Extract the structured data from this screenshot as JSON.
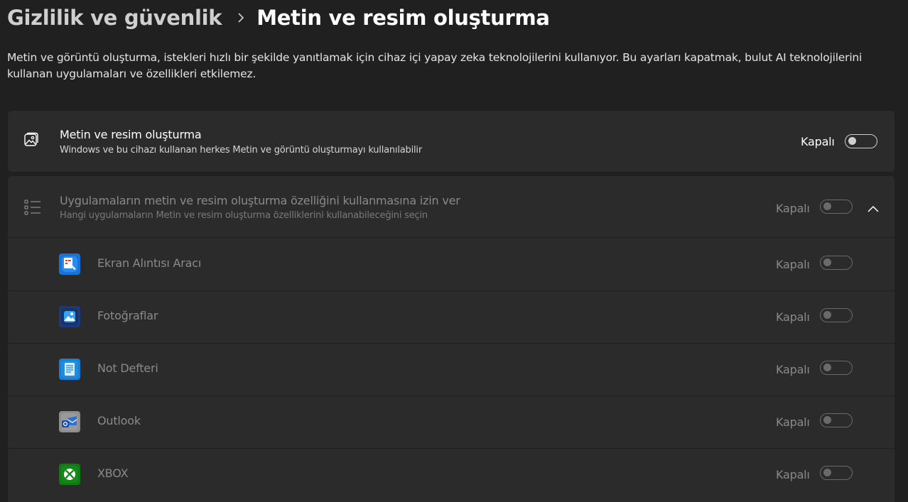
{
  "breadcrumb": {
    "parent": "Gizlilik ve güvenlik",
    "current": "Metin ve resim oluşturma"
  },
  "description": "Metin ve görüntü oluşturma, istekleri hızlı bir şekilde yanıtlamak için cihaz içi yapay zeka teknolojilerini kullanıyor. Bu ayarları kapatmak, bulut AI teknolojilerini kullanan uygulamaları ve özellikleri etkilemez.",
  "main_setting": {
    "title": "Metin ve resim oluşturma",
    "subtitle": "Windows ve bu cihazı kullanan herkes Metin ve görüntü oluşturmayı kullanılabilir",
    "state": "Kapalı",
    "icon": "image-generation-icon"
  },
  "apps_section": {
    "title": "Uygulamaların metin ve resim oluşturma özelliğini kullanmasına izin ver",
    "subtitle": "Hangi uygulamaların Metin ve resim oluşturma özelliklerini kullanabileceğini seçin",
    "state": "Kapalı",
    "icon": "list-icon",
    "apps": [
      {
        "name": "Ekran Alıntısı Aracı",
        "state": "Kapalı",
        "icon": "snipping-tool-icon"
      },
      {
        "name": "Fotoğraflar",
        "state": "Kapalı",
        "icon": "photos-icon"
      },
      {
        "name": "Not Defteri",
        "state": "Kapalı",
        "icon": "notepad-icon"
      },
      {
        "name": "Outlook",
        "state": "Kapalı",
        "icon": "outlook-icon"
      },
      {
        "name": "XBOX",
        "state": "Kapalı",
        "icon": "xbox-icon"
      }
    ]
  },
  "colors": {
    "background": "#202020",
    "card": "#2b2b2b",
    "text": "#ffffff",
    "disabled_text": "#8a8a8a"
  }
}
